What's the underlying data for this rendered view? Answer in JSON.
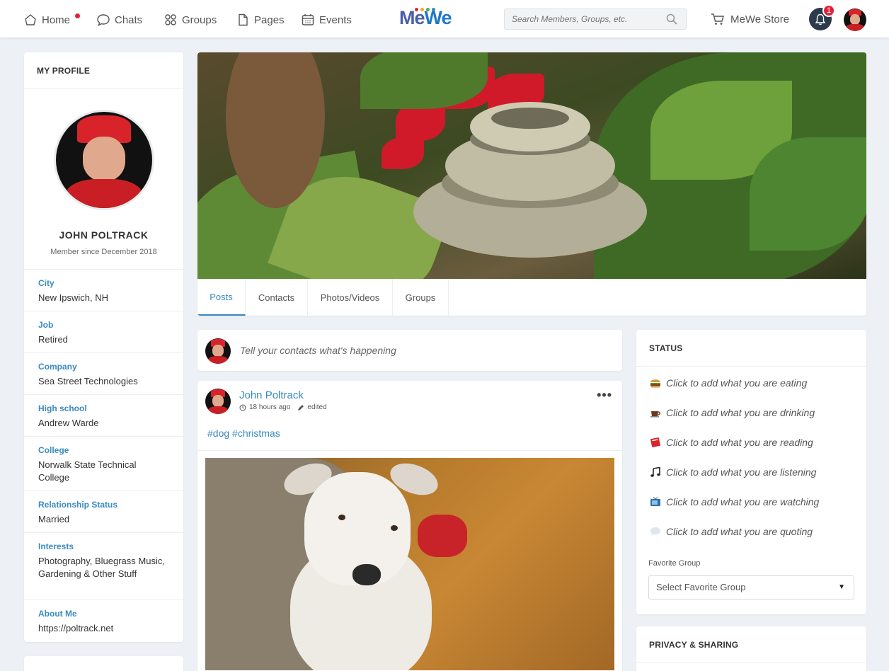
{
  "nav": {
    "home": "Home",
    "chats": "Chats",
    "groups": "Groups",
    "pages": "Pages",
    "events": "Events",
    "logo_m": "Me",
    "logo_we": "We",
    "search_placeholder": "Search Members, Groups, etc.",
    "store": "MeWe Store",
    "notification_count": "1"
  },
  "profile": {
    "header": "MY PROFILE",
    "name": "JOHN POLTRACK",
    "member_since": "Member since December 2018",
    "fields": [
      {
        "label": "City",
        "value": "New Ipswich, NH"
      },
      {
        "label": "Job",
        "value": "Retired"
      },
      {
        "label": "Company",
        "value": "Sea Street Technologies"
      },
      {
        "label": "High school",
        "value": "Andrew Warde"
      },
      {
        "label": "College",
        "value": "Norwalk State Technical College"
      },
      {
        "label": "Relationship Status",
        "value": "Married"
      },
      {
        "label": "Interests",
        "value": "Photography, Bluegrass Music, Gardening & Other Stuff"
      },
      {
        "label": "About Me",
        "value": "https://poltrack.net"
      }
    ]
  },
  "tabs": [
    "Posts",
    "Contacts",
    "Photos/Videos",
    "Groups"
  ],
  "composer": {
    "placeholder": "Tell your contacts what's happening"
  },
  "post": {
    "author": "John Poltrack",
    "time": "18 hours ago",
    "edited": "edited",
    "more": "•••",
    "tags": "#dog #christmas"
  },
  "status": {
    "header": "STATUS",
    "items": [
      {
        "icon": "burger-icon",
        "text": "Click to add what you are eating"
      },
      {
        "icon": "coffee-icon",
        "text": "Click to add what you are drinking"
      },
      {
        "icon": "book-icon",
        "text": "Click to add what you are reading"
      },
      {
        "icon": "music-note-icon",
        "text": "Click to add what you are listening"
      },
      {
        "icon": "tv-icon",
        "text": "Click to add what you are watching"
      },
      {
        "icon": "speech-bubble-icon",
        "text": "Click to add what you are quoting"
      }
    ],
    "favorite_label": "Favorite Group",
    "favorite_select": "Select Favorite Group"
  },
  "privacy": {
    "header": "PRIVACY & SHARING"
  },
  "colors": {
    "accent": "#3a8ac0",
    "notification": "#e0233a",
    "background": "#edf0f4"
  }
}
